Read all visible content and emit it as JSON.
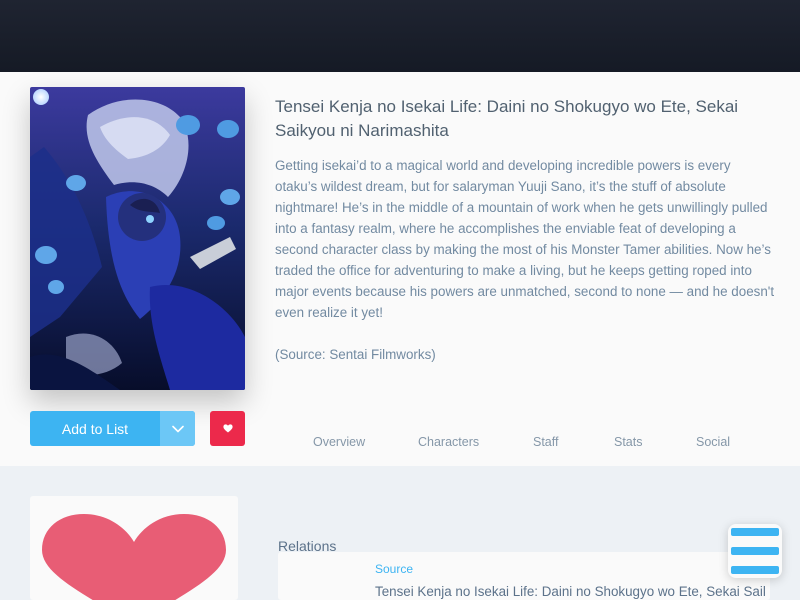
{
  "media": {
    "title": "Tensei Kenja no Isekai Life: Daini no Shokugyo wo Ete, Sekai Saikyou ni Narimashita",
    "description": "Getting isekai’d to a magical world and developing incredible powers is every otaku’s wildest dream, but for salaryman Yuuji Sano, it’s the stuff of absolute nightmare! He’s in the middle of a mountain of work when he gets unwillingly pulled into a fantasy realm, where he accomplishes the enviable feat of developing a second character class by making the most of his Monster Tamer abilities. Now he’s traded the office for adventuring to make a living, but he keeps getting roped into major events because his powers are unmatched, second to none — and he doesn't even realize it yet!",
    "source_note": "(Source: Sentai Filmworks)"
  },
  "actions": {
    "add_to_list_label": "Add to List",
    "dropdown_icon": "chevron-down-icon",
    "favorite_icon": "heart-icon"
  },
  "tabs": [
    "Overview",
    "Characters",
    "Staff",
    "Stats",
    "Social"
  ],
  "relations": {
    "heading": "Relations",
    "items": [
      {
        "type": "Source",
        "name": "Tensei Kenja no Isekai Life: Daini no Shokugyo wo Ete, Sekai Saikyou ni Narimashita"
      }
    ]
  },
  "colors": {
    "accent": "#3db4f2",
    "favorite": "#ec294b",
    "heart_graphic": "#e85d75",
    "banner": "#151a25"
  }
}
